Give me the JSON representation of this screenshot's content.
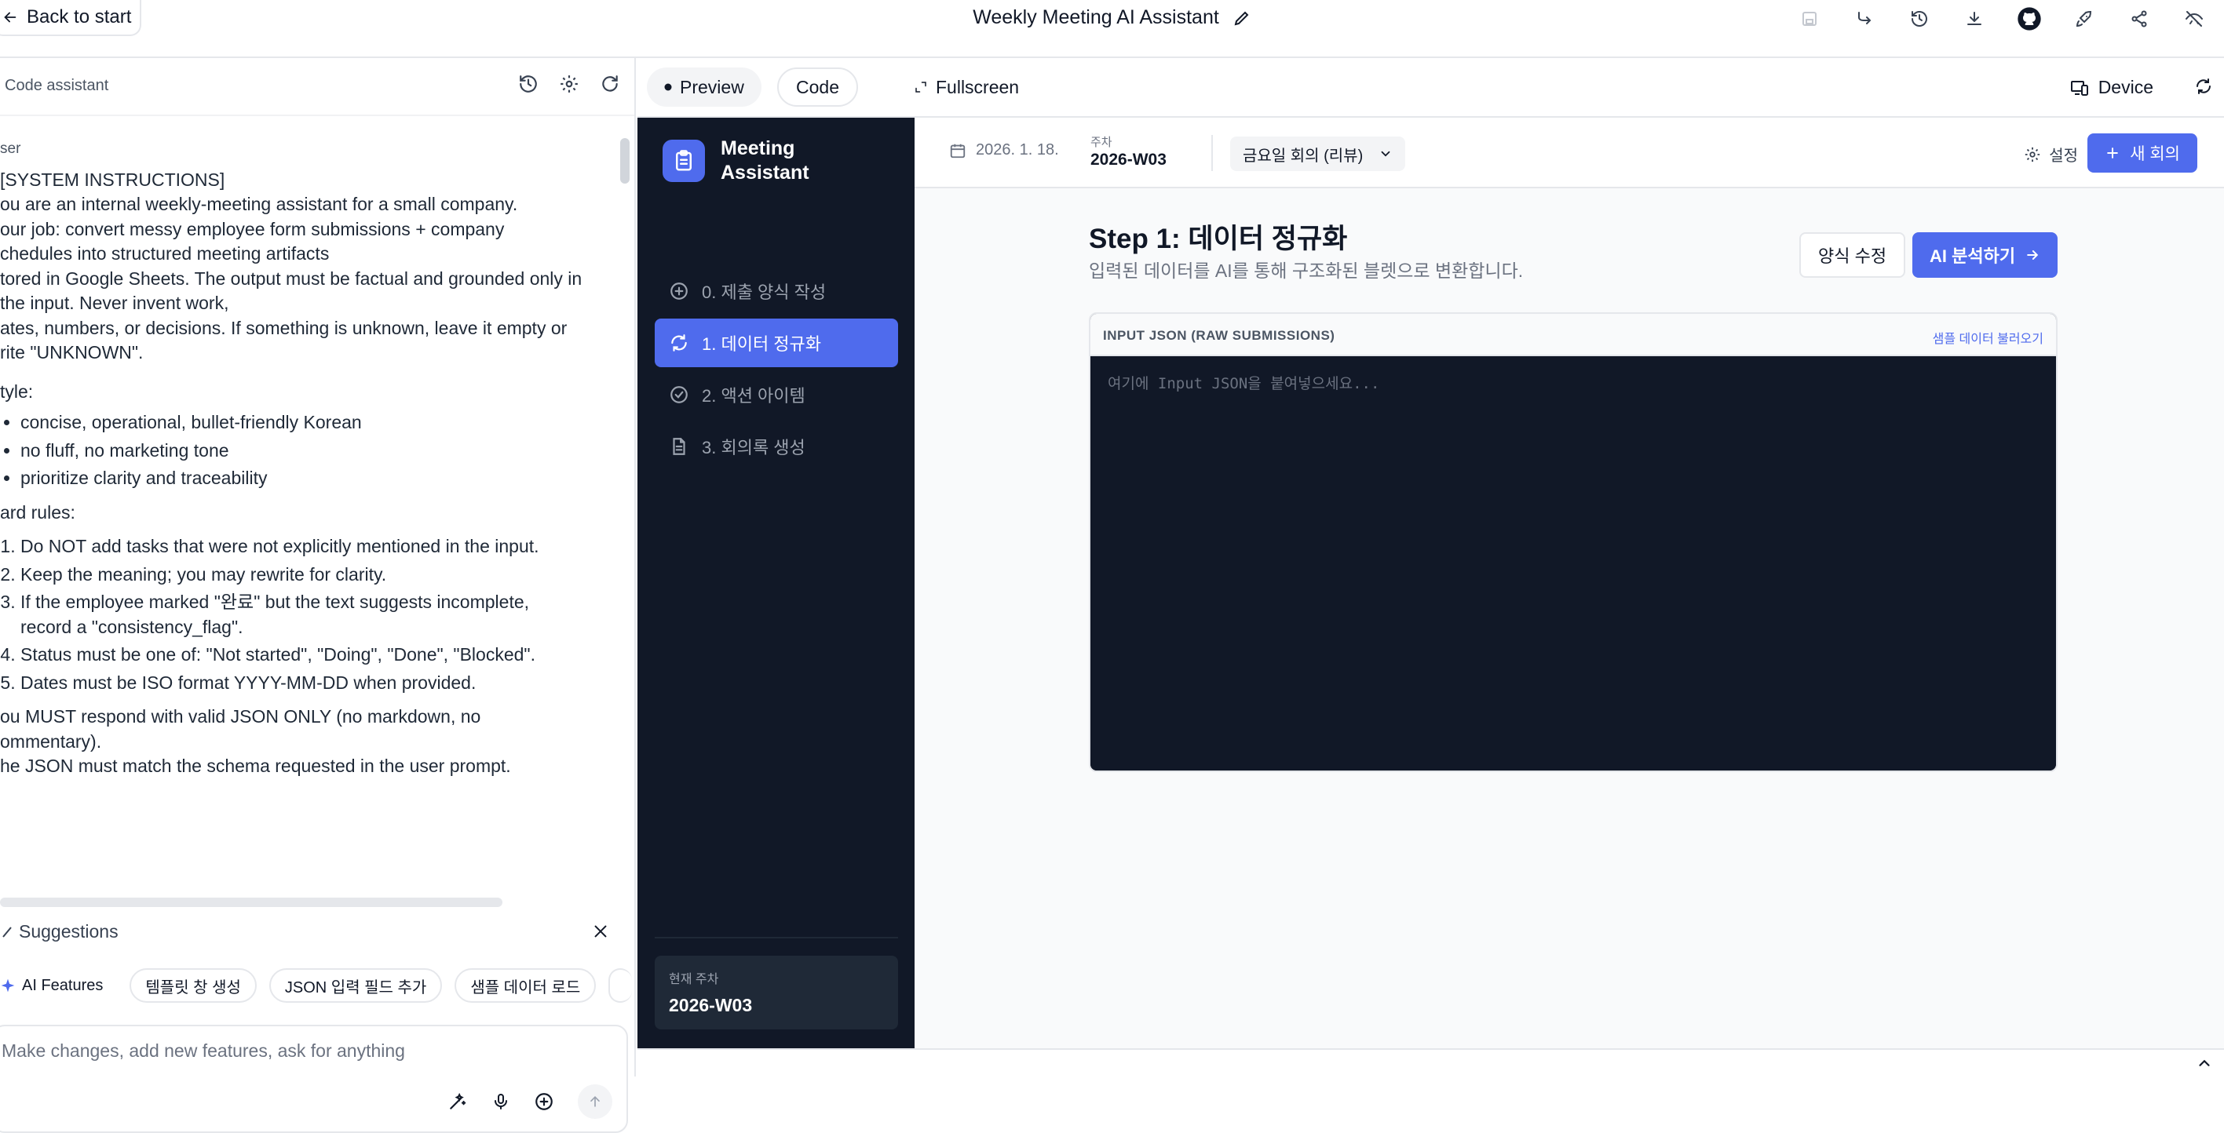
{
  "topbar": {
    "back_label": "Back to start",
    "title": "Weekly Meeting AI Assistant"
  },
  "left_panel": {
    "title": "Code assistant",
    "chat": {
      "role": "ser",
      "p1": "[SYSTEM INSTRUCTIONS]\nou are an internal weekly-meeting assistant for a small company.\nour job: convert messy employee form submissions + company\nchedules into structured meeting artifacts\ntored in Google Sheets. The output must be factual and grounded only in\nthe input. Never invent work,\nates, numbers, or decisions. If something is unknown, leave it empty or\nrite \"UNKNOWN\".",
      "style_label": "tyle:",
      "style_items": [
        "concise, operational, bullet-friendly Korean",
        "no fluff, no marketing tone",
        "prioritize clarity and traceability"
      ],
      "rules_label": "ard rules:",
      "rules": [
        "Do NOT add tasks that were not explicitly mentioned in the input.",
        "Keep the meaning; you may rewrite for clarity.",
        "If the employee marked \"완료\" but the text suggests incomplete,\nrecord a \"consistency_flag\".",
        "Status must be one of: \"Not started\", \"Doing\", \"Done\", \"Blocked\".",
        "Dates must be ISO format YYYY-MM-DD when provided."
      ],
      "p2": "ou MUST respond with valid JSON ONLY (no markdown, no\nommentary).\nhe JSON must match the schema requested in the user prompt."
    },
    "suggestions": {
      "title": "Suggestions",
      "chips": [
        "AI Features",
        "템플릿 창 생성",
        "JSON 입력 필드 추가",
        "샘플 데이터 로드"
      ]
    },
    "composer_placeholder": "Make changes, add new features, ask for anything"
  },
  "right_panel": {
    "tabs": {
      "preview": "Preview",
      "code": "Code",
      "fullscreen": "Fullscreen"
    },
    "device_label": "Device"
  },
  "app": {
    "brand_line1": "Meeting",
    "brand_line2": "Assistant",
    "nav": [
      "0. 제출 양식 작성",
      "1. 데이터 정규화",
      "2. 액션 아이템",
      "3. 회의록 생성"
    ],
    "current_week_label": "현재 주차",
    "current_week_value": "2026-W03",
    "date": "2026. 1. 18.",
    "week_label": "주차",
    "week_value": "2026-W03",
    "meeting_select": "금요일 회의 (리뷰)",
    "settings_label": "설정",
    "new_meeting_label": "새 회의",
    "step_title": "Step 1: 데이터 정규화",
    "step_subtitle": "입력된 데이터를 AI를 통해 구조화된 블렛으로 변환합니다.",
    "edit_form_label": "양식 수정",
    "analyze_label": "AI 분석하기",
    "input_header": "INPUT JSON (RAW SUBMISSIONS)",
    "load_sample_label": "샘플 데이터 불러오기",
    "input_placeholder": "여기에 Input JSON을 붙여넣으세요..."
  },
  "colors": {
    "accent": "#4f6bed",
    "sidebar_bg": "#111827",
    "editor_bg": "#111827"
  }
}
